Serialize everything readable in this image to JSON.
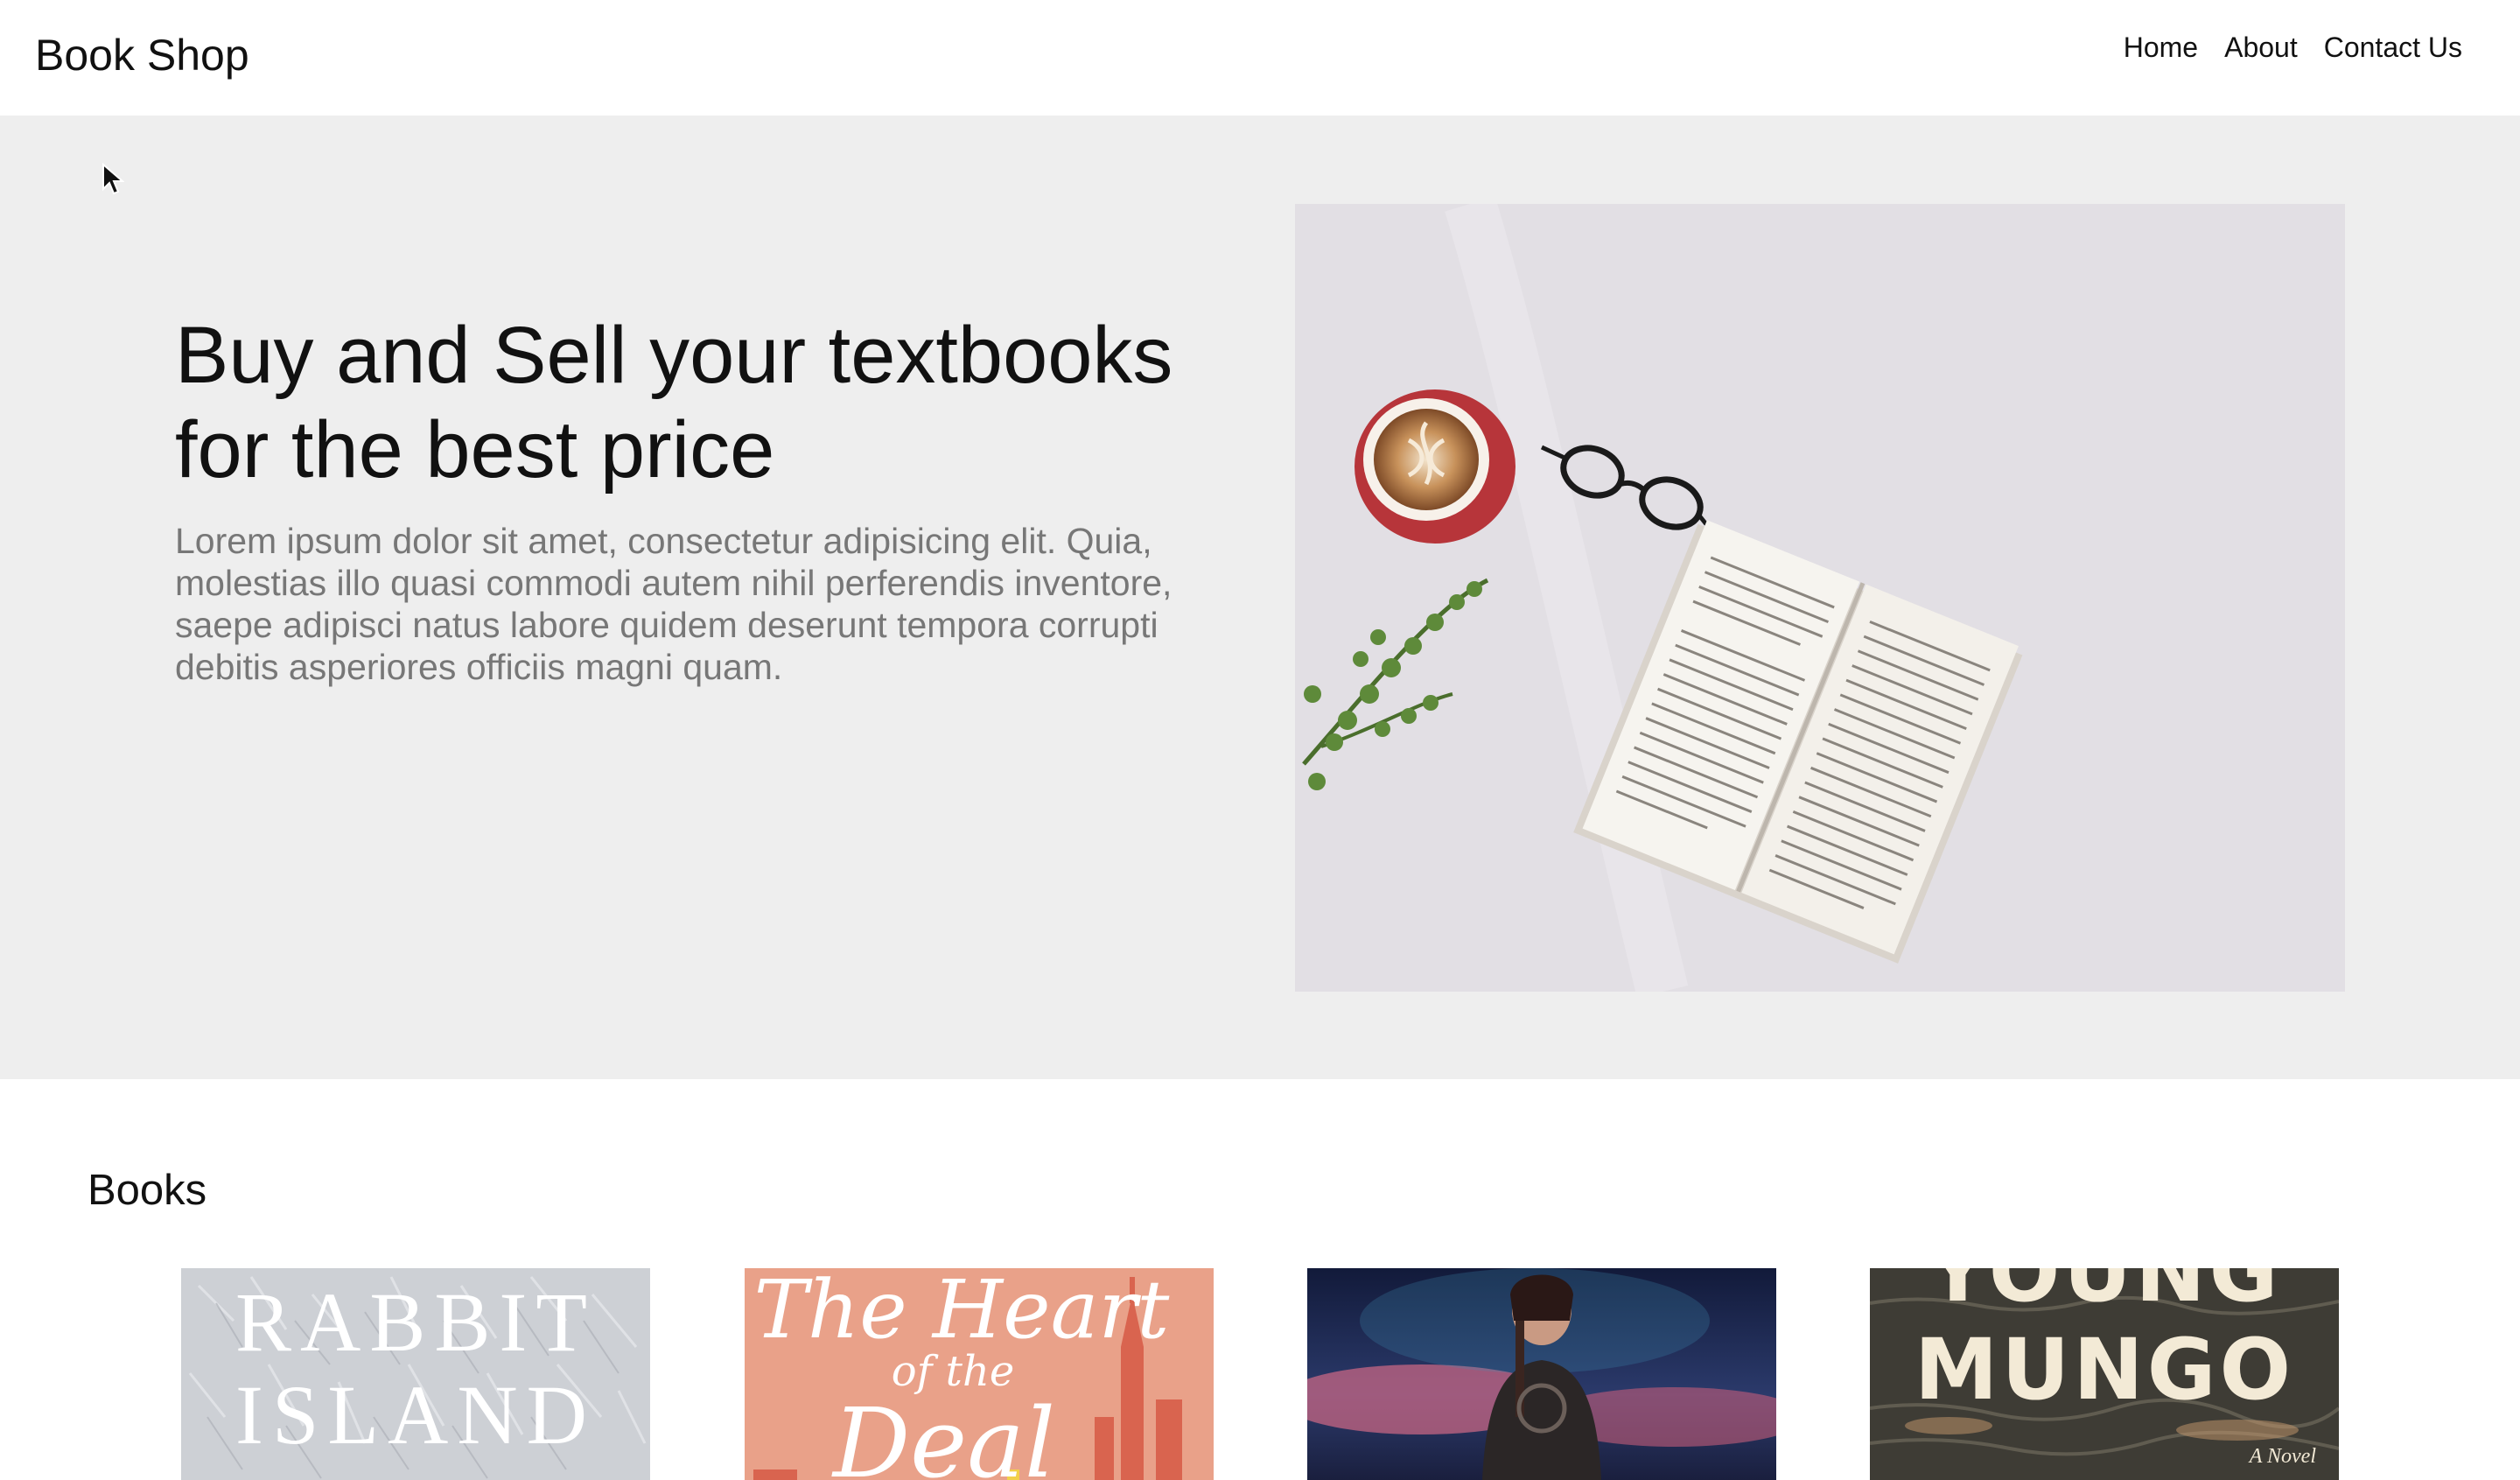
{
  "header": {
    "brand": "Book Shop",
    "nav": [
      {
        "label": "Home"
      },
      {
        "label": "About"
      },
      {
        "label": "Contact Us"
      }
    ]
  },
  "hero": {
    "title": "Buy and Sell your textbooks for the best price",
    "subtitle": "Lorem ipsum dolor sit amet, consectetur adipisicing elit. Quia, molestias illo quasi commodi autem nihil perferendis inventore, saepe adipisci natus labore quidem deserunt tempora corrupti debitis asperiores officiis magni quam.",
    "image_icon": "open-book-coffee-photo"
  },
  "books": {
    "title": "Books",
    "items": [
      {
        "cover_lines": [
          "RABBIT",
          "ISLAND"
        ],
        "color": "#cccfd4"
      },
      {
        "cover_lines": [
          "The Heart",
          "of the",
          "Deal"
        ],
        "color": "#e79f88"
      },
      {
        "cover_lines": [],
        "color": "#1b2242"
      },
      {
        "cover_lines": [
          "YOUNG",
          "MUNGO",
          "A Novel"
        ],
        "color": "#3b3a33"
      }
    ]
  }
}
